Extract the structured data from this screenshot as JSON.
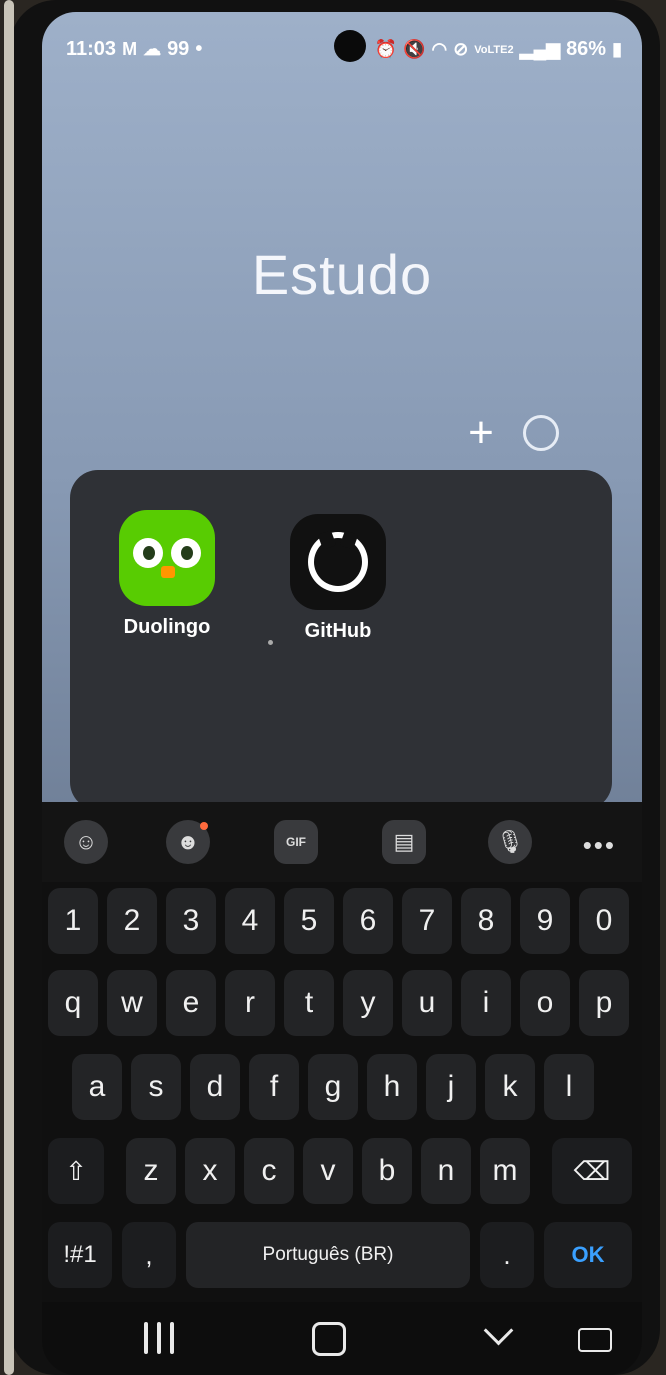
{
  "status_bar": {
    "time": "11:03",
    "mail_icon": "gmail-icon",
    "cloud_icon": "cloud-upload-icon",
    "badge_count": "99",
    "dot": "•",
    "battery": "86%",
    "signal_label": "VoLTE2"
  },
  "folder": {
    "title": "Estudo",
    "add_label": "+",
    "apps": [
      {
        "name": "Duolingo",
        "icon": "duolingo-icon",
        "color": "#58cc02"
      },
      {
        "name": "GitHub",
        "icon": "github-icon",
        "color": "#111111"
      }
    ]
  },
  "keyboard_toolbar": {
    "items": [
      "emoji-icon",
      "sticker-icon",
      "gif-icon",
      "clipboard-icon",
      "microphone-icon"
    ],
    "more": "•••",
    "gif_label": "GIF"
  },
  "keyboard": {
    "numbers": [
      "1",
      "2",
      "3",
      "4",
      "5",
      "6",
      "7",
      "8",
      "9",
      "0"
    ],
    "row1": [
      "q",
      "w",
      "e",
      "r",
      "t",
      "y",
      "u",
      "i",
      "o",
      "p"
    ],
    "row2": [
      "a",
      "s",
      "d",
      "f",
      "g",
      "h",
      "j",
      "k",
      "l"
    ],
    "row3": [
      "z",
      "x",
      "c",
      "v",
      "b",
      "n",
      "m"
    ],
    "shift": "⇧",
    "backspace": "⌫",
    "symbols": "!#1",
    "comma": ",",
    "space": "Português (BR)",
    "period": ".",
    "ok": "OK"
  },
  "nav": {
    "recents_icon": "recents-icon",
    "home_icon": "home-icon",
    "back_icon": "hide-keyboard-icon",
    "keyboard_icon": "keyboard-switch-icon"
  }
}
